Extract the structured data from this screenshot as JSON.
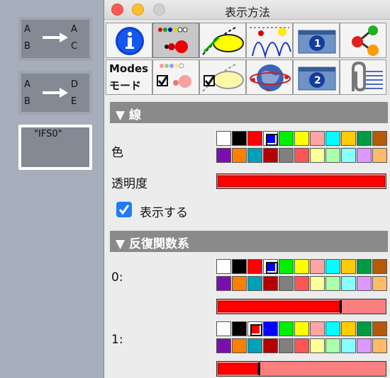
{
  "window": {
    "title": "表示方法"
  },
  "canvas": {
    "nodes": [
      {
        "id": "node-ab-ac",
        "left": [
          "A",
          "B"
        ],
        "right": [
          "A",
          "C"
        ]
      },
      {
        "id": "node-ab-de",
        "left": [
          "A",
          "B"
        ],
        "right": [
          "D",
          "E"
        ]
      }
    ],
    "selected_node": {
      "label": "\"IFS0\""
    }
  },
  "toolbar": {
    "row1": [
      {
        "name": "info-icon",
        "active": false
      },
      {
        "name": "points-style-icon",
        "active": true
      },
      {
        "name": "curve-ellipse-icon",
        "active": false
      },
      {
        "name": "arcs-icon",
        "active": false
      },
      {
        "name": "window-one-icon",
        "active": false
      },
      {
        "name": "nodes-graph-icon",
        "active": false
      }
    ],
    "row2": [
      {
        "name": "modes-icon",
        "label_top": "Modes",
        "label_bottom": "モード",
        "active": false
      },
      {
        "name": "checkbox-points-icon",
        "active": false
      },
      {
        "name": "checkbox-ellipse-icon",
        "active": false
      },
      {
        "name": "globe-icon",
        "active": false
      },
      {
        "name": "window-two-icon",
        "active": false
      },
      {
        "name": "clip-list-icon",
        "active": false
      }
    ]
  },
  "sections": {
    "line": {
      "header": "▼ 線",
      "color_label": "色",
      "opacity_label": "透明度",
      "show_label": "表示する",
      "show_checked": true,
      "opacity_value": 1.0
    },
    "iterated": {
      "header": "▼ 反復関数系",
      "items": [
        {
          "label": "0:",
          "opacity_value": 0.73
        },
        {
          "label": "1:",
          "opacity_value": 0.24
        }
      ]
    }
  },
  "palette": {
    "row1": [
      "#ffffff",
      "#000000",
      "#ff0000",
      "#0000ff",
      "#00ee00",
      "#ffff00",
      "#ffa5a5",
      "#00ffff",
      "#ffcc00",
      "#009944",
      "#b45a0a"
    ],
    "row2": [
      "#7a0fb0",
      "#ff7f00",
      "#00a0b8",
      "#b40000",
      "#808080",
      "#ff5555",
      "#ffff99",
      "#aaffaa",
      "#88ffff",
      "#dd99ff",
      "#ffbb66"
    ],
    "selected": {
      "line": 3,
      "iter0": 3,
      "iter1": 2
    }
  }
}
